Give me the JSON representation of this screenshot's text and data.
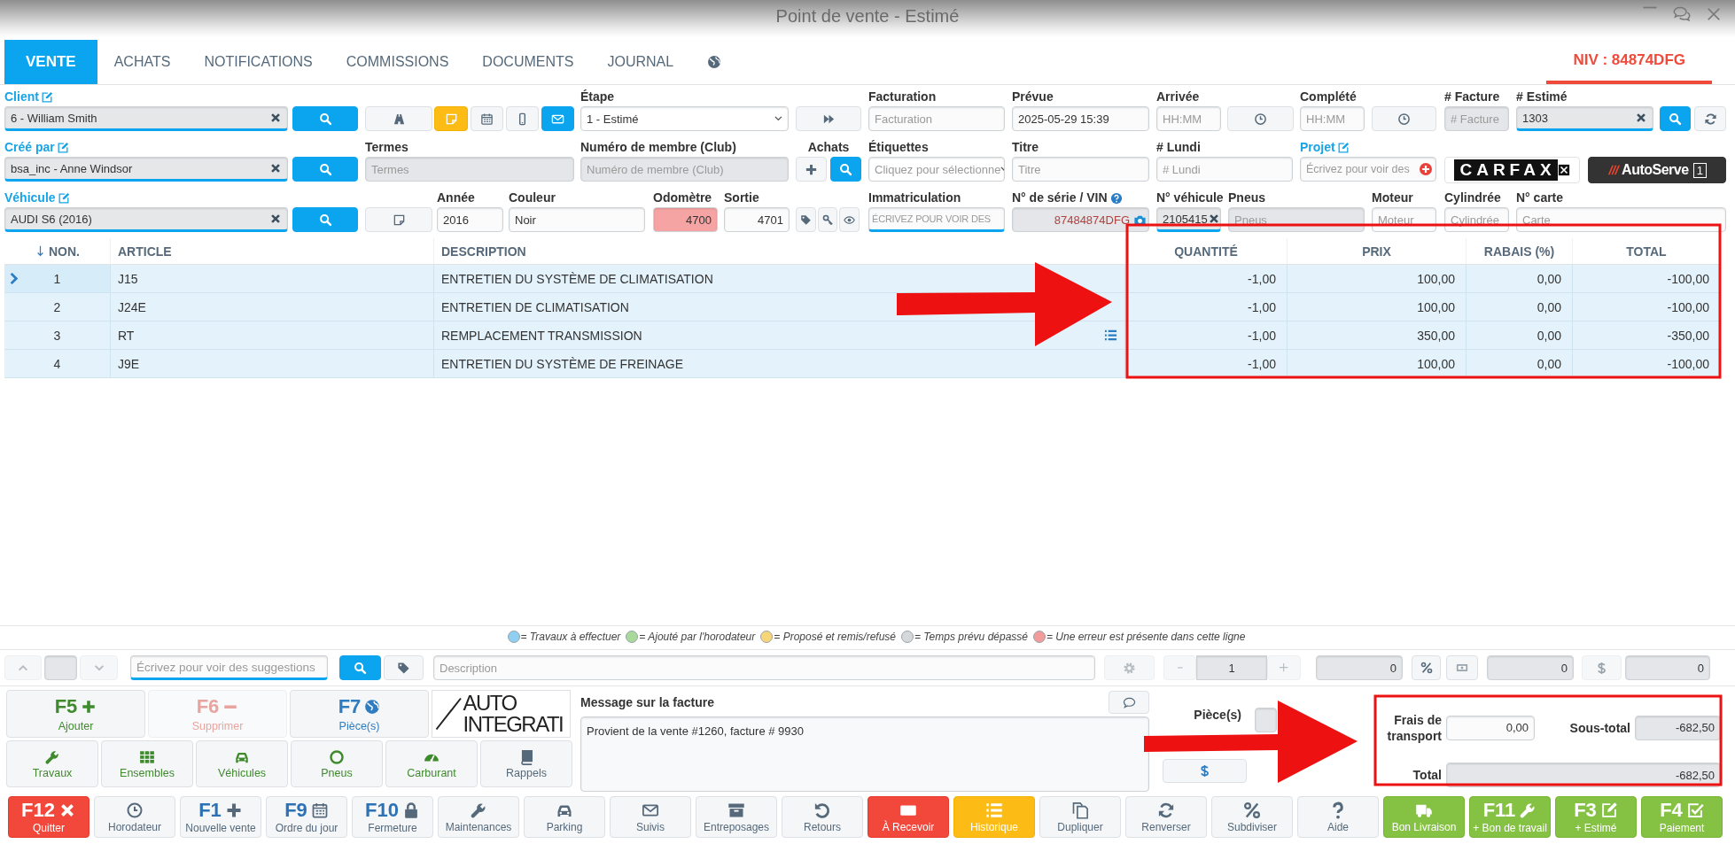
{
  "window": {
    "title": "Point de vente - Estimé"
  },
  "tabs": [
    {
      "kind": "text",
      "label": "VENTE",
      "selected": true
    },
    {
      "kind": "text",
      "label": "ACHATS",
      "selected": false
    },
    {
      "kind": "text",
      "label": "NOTIFICATIONS",
      "selected": false
    },
    {
      "kind": "text",
      "label": "COMMISSIONS",
      "selected": false
    },
    {
      "kind": "text",
      "label": "DOCUMENTS",
      "selected": false
    },
    {
      "kind": "text",
      "label": "JOURNAL",
      "selected": false
    },
    {
      "kind": "globe",
      "selected": false
    }
  ],
  "vin_tab": {
    "label": "NIV : 84874DFG",
    "selected": true
  },
  "form": {
    "groups": [
      {
        "fields": [
          {
            "kind": "lookup",
            "label": "Client",
            "link": true,
            "value": "6 - William Smith"
          },
          {
            "kind": "button"
          },
          {
            "kind": "button"
          },
          {
            "kind": "button"
          },
          {
            "kind": "button"
          },
          {
            "kind": "button"
          },
          {
            "kind": "button"
          },
          {
            "kind": "select",
            "label": "Étape",
            "value": "1 - Estimé"
          },
          {
            "kind": "button"
          },
          {
            "kind": "field",
            "label": "Facturation",
            "placeholder": "Facturation",
            "disabled": false
          },
          {
            "kind": "field",
            "label": "Prévue",
            "value": "2025-05-29 15:39",
            "disabled": false
          },
          {
            "kind": "field",
            "label": "Arrivée",
            "placeholder": "HH:MM",
            "disabled": false
          },
          {
            "kind": "button"
          },
          {
            "kind": "field",
            "label": "Complété",
            "placeholder": "HH:MM",
            "disabled": false
          },
          {
            "kind": "button"
          },
          {
            "kind": "field",
            "label": "# Facture",
            "placeholder": "# Facture",
            "disabled": true
          },
          {
            "kind": "lookup",
            "label": "# Estimé",
            "link": false,
            "value": "1303"
          },
          {
            "kind": "button"
          },
          {
            "kind": "button"
          }
        ]
      },
      {
        "fields": [
          {
            "kind": "lookup",
            "label": "Créé par",
            "link": true,
            "value": "bsa_inc - Anne Windsor"
          },
          {
            "kind": "button"
          },
          {
            "kind": "field",
            "label": "Termes",
            "placeholder": "Termes",
            "disabled": true
          },
          {
            "kind": "field",
            "label": "Numéro de membre (Club)",
            "placeholder": "Numéro de membre (Club)",
            "disabled": true
          },
          {
            "kind": "group",
            "label": "Achats"
          },
          {
            "kind": "select",
            "label": "Étiquettes",
            "placeholder": "Cliquez pour sélectionne"
          },
          {
            "kind": "field",
            "label": "Titre",
            "placeholder": "Titre",
            "disabled": false
          },
          {
            "kind": "field",
            "label": "# Lundi",
            "placeholder": "# Lundi",
            "disabled": false
          },
          {
            "kind": "project",
            "label": "Projet",
            "link": true,
            "placeholder": "Écrivez pour voir des"
          },
          {
            "kind": "carfax",
            "text": "CARFAX"
          },
          {
            "kind": "autoserve",
            "text": "AutoServe",
            "badge": "1"
          }
        ]
      },
      {
        "fields": [
          {
            "kind": "lookup",
            "label": "Véhicule",
            "link": true,
            "value": "AUDI S6 (2016)"
          },
          {
            "kind": "button"
          },
          {
            "kind": "button"
          },
          {
            "kind": "field",
            "label": "Année",
            "value": "2016",
            "disabled": false
          },
          {
            "kind": "field",
            "label": "Couleur",
            "value": "Noir",
            "disabled": false
          },
          {
            "kind": "number",
            "label": "Odomètre",
            "value": "4700",
            "error": true
          },
          {
            "kind": "number",
            "label": "Sortie",
            "value": "4701",
            "error": false
          },
          {
            "kind": "icons"
          },
          {
            "kind": "suggest",
            "label": "Immatriculation",
            "placeholder": "ÉCRIVEZ POUR VOIR DES"
          },
          {
            "kind": "vin",
            "label": "N° de série / VIN",
            "value": "87484874DFG"
          },
          {
            "kind": "lookup",
            "label": "N° véhicule",
            "link": false,
            "value": "2105415"
          },
          {
            "kind": "field",
            "label": "Pneus",
            "placeholder": "Pneus",
            "disabled": true
          },
          {
            "kind": "field",
            "label": "Moteur",
            "placeholder": "Moteur",
            "disabled": false
          },
          {
            "kind": "field",
            "label": "Cylindrée",
            "placeholder": "Cylindrée",
            "disabled": false
          },
          {
            "kind": "field",
            "label": "N° carte",
            "placeholder": "Carte",
            "disabled": false
          }
        ]
      }
    ]
  },
  "table": {
    "columns": [
      {
        "label": "NON.",
        "sorted": true
      },
      {
        "label": "ARTICLE",
        "sorted": false
      },
      {
        "label": "DESCRIPTION",
        "sorted": false
      },
      {
        "label": "QUANTITÉ",
        "sorted": false
      },
      {
        "label": "PRIX",
        "sorted": false
      },
      {
        "label": "RABAIS (%)",
        "sorted": false
      },
      {
        "label": "TOTAL",
        "sorted": false
      }
    ],
    "rows": [
      {
        "selected": true,
        "details": false,
        "cells": [
          "1",
          "J15",
          "ENTRETIEN DU SYSTÈME DE CLIMATISATION",
          "-1,00",
          "100,00",
          "0,00",
          "-100,00"
        ]
      },
      {
        "selected": false,
        "details": false,
        "cells": [
          "2",
          "J24E",
          "ENTRETIEN DE CLIMATISATION",
          "-1,00",
          "100,00",
          "0,00",
          "-100,00"
        ]
      },
      {
        "selected": false,
        "details": true,
        "cells": [
          "3",
          "RT",
          "REMPLACEMENT TRANSMISSION",
          "-1,00",
          "350,00",
          "0,00",
          "-350,00"
        ]
      },
      {
        "selected": false,
        "details": false,
        "cells": [
          "4",
          "J9E",
          "ENTRETIEN DU SYSTÈME DE FREINAGE",
          "-1,00",
          "100,00",
          "0,00",
          "-100,00"
        ]
      }
    ]
  },
  "legend": [
    {
      "color": "#8ecff2",
      "text": "= Travaux à effectuer"
    },
    {
      "color": "#a9d89b",
      "text": "= Ajouté par l'horodateur"
    },
    {
      "color": "#f7d67a",
      "text": "= Proposé et remis/refusé"
    },
    {
      "color": "#d5d8db",
      "text": "= Temps prévu dépassé"
    },
    {
      "color": "#f29b9b",
      "text": "= Une erreur est présente dans cette ligne"
    }
  ],
  "item_bar": {
    "search_placeholder": "Écrivez pour voir des suggestions",
    "description_placeholder": "Description",
    "quantity": "1",
    "amounts": [
      "0",
      "0",
      "0"
    ]
  },
  "actions": {
    "main": [
      {
        "key": "F5",
        "label": "Ajouter",
        "disabled": false
      },
      {
        "key": "F6",
        "label": "Supprimer",
        "disabled": true
      },
      {
        "key": "F7",
        "label": "Pièce(s)",
        "disabled": false
      }
    ],
    "logo": [
      "AUTO",
      "INTEGRATI"
    ],
    "categories": [
      "Travaux",
      "Ensembles",
      "Véhicules",
      "Pneus",
      "Carburant",
      "Rappels"
    ]
  },
  "message": {
    "label": "Message sur la facture",
    "value": "Provient de la vente #1260, facture # 9930"
  },
  "totals": {
    "parts_label": "Pièce(s)",
    "shipping_label": "Frais de transport",
    "shipping": "0,00",
    "subtotal_label": "Sous-total",
    "subtotal": "-682,50",
    "total_label": "Total",
    "total": "-682,50"
  },
  "bottom_bar": [
    {
      "key": "F12",
      "label": "Quitter"
    },
    {
      "label": "Horodateur"
    },
    {
      "key": "F1",
      "label": "Nouvelle vente"
    },
    {
      "key": "F9",
      "label": "Ordre du jour"
    },
    {
      "key": "F10",
      "label": "Fermeture"
    },
    {
      "label": "Maintenances"
    },
    {
      "label": "Parking"
    },
    {
      "label": "Suivis"
    },
    {
      "label": "Entreposages"
    },
    {
      "label": "Retours"
    },
    {
      "label": "À Recevoir"
    },
    {
      "label": "Historique"
    },
    {
      "label": "Dupliquer"
    },
    {
      "label": "Renverser"
    },
    {
      "label": "Subdiviser"
    },
    {
      "label": "Aide"
    },
    {
      "label": "Bon Livraison"
    },
    {
      "key": "F11",
      "label": "+ Bon de travail"
    },
    {
      "key": "F3",
      "label": "+ Estimé"
    },
    {
      "key": "F4",
      "label": "Paiement"
    }
  ],
  "annotations": [
    {
      "kind": "frame"
    },
    {
      "kind": "arrow"
    },
    {
      "kind": "arrow"
    },
    {
      "kind": "frame"
    }
  ]
}
